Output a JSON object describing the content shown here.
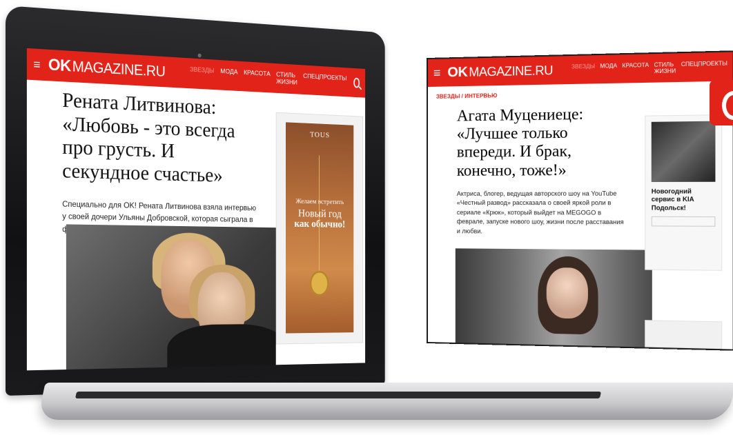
{
  "laptop": {
    "logo": {
      "ok": "OK",
      "magazine": "MAGAZINE.RU"
    },
    "nav": [
      "ЗВЕЗДЫ",
      "МОДА",
      "КРАСОТА",
      "СТИЛЬ ЖИЗНИ",
      "СПЕЦПРОЕКТЫ"
    ],
    "article": {
      "title": "Рената Литвинова: «Любовь - это всегда про грусть. И секундное счастье»",
      "lead": "Специально для OK! Рената Литвинова взяла интервью у своей дочери Ульяны Добровской, которая сыграла в фильме Литвиновой «Северный ветер»."
    },
    "ad": {
      "brand": "TOUS",
      "line1": "Желаем встретить",
      "line2": "Новый год",
      "line3": "как обычно!"
    }
  },
  "tablet": {
    "logo": {
      "ok": "OK",
      "magazine": "MAGAZINE.RU"
    },
    "nav": [
      "ЗВЕЗДЫ",
      "МОДА",
      "КРАСОТА",
      "СТИЛЬ ЖИЗНИ",
      "СПЕЦПРОЕКТЫ"
    ],
    "breadcrumb": "ЗВЕЗДЫ / ИНТЕРВЬЮ",
    "article": {
      "title": "Агата Муцениеце: «Лучшее только впереди. И брак, конечно, тоже!»",
      "lead": "Актриса, блогер, ведущая авторского шоу на YouTube «Честный развод» рассказала о своей яркой роли в сериале «Крюк», который выйдет на MEGOGO в феврале, запуске нового шоу, жизни после расставания и любви."
    },
    "promo": {
      "title": "Новогодний сервис в KIA Подольск!"
    }
  },
  "colors": {
    "brand_red": "#e2231a"
  }
}
